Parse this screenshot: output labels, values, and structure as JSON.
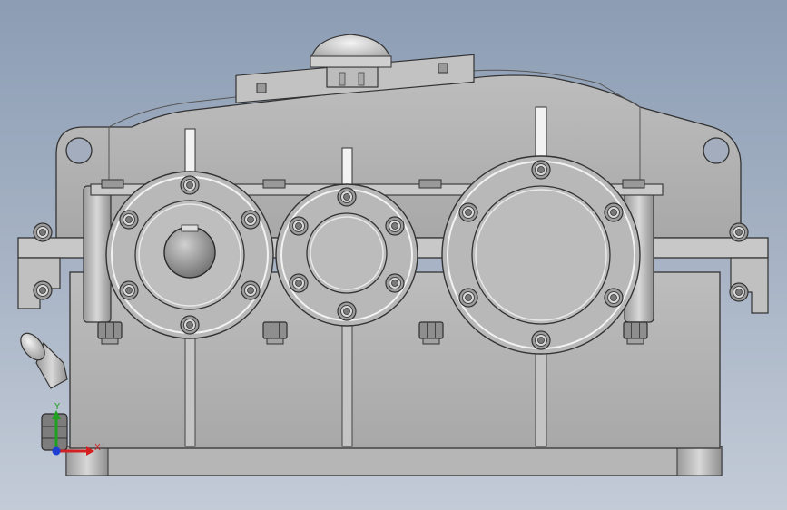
{
  "viewport": {
    "model": "gear-reducer-housing",
    "view": "front"
  },
  "triad": {
    "x_label": "X",
    "y_label": "Y",
    "colors": {
      "x": "#d42020",
      "y": "#1fa01f",
      "z": "#1f3fd4"
    }
  },
  "colors": {
    "background_top": "#8c9db4",
    "background_bottom": "#c3cbd7",
    "housing": "#b3b3b3",
    "housing_dark": "#9a9a9a",
    "edge": "#3a3a3a",
    "bolt": "#8a8a8a"
  }
}
